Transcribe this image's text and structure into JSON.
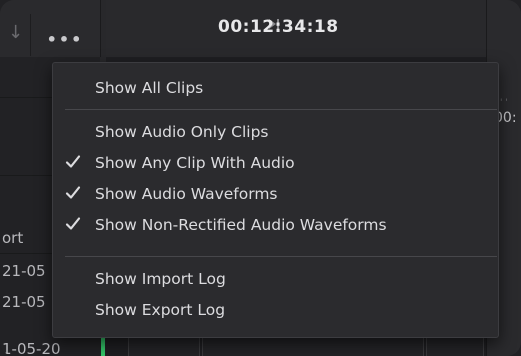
{
  "toolbar": {
    "more_label": "•••",
    "arrow_glyph": "↓"
  },
  "viewer": {
    "timecode": "00:12:34:18"
  },
  "ruler": {
    "timecode_partial": "00:"
  },
  "left_list": {
    "cells": [
      "ort",
      "21-05",
      "21-05",
      "1-05-20"
    ]
  },
  "menu": {
    "groups": [
      {
        "items": [
          {
            "label": "Show All Clips",
            "checked": false
          }
        ]
      },
      {
        "items": [
          {
            "label": "Show Audio Only Clips",
            "checked": false
          },
          {
            "label": "Show Any Clip With Audio",
            "checked": true
          },
          {
            "label": "Show Audio Waveforms",
            "checked": true
          },
          {
            "label": "Show Non-Rectified Audio Waveforms",
            "checked": true
          }
        ]
      },
      {
        "items": [
          {
            "label": "Show Import Log",
            "checked": false
          },
          {
            "label": "Show Export Log",
            "checked": false
          }
        ]
      }
    ]
  },
  "colors": {
    "background": "#212124",
    "menu_bg": "#2b2b2e",
    "menu_text": "#dcdcdf",
    "accent_green": "#34c86a"
  }
}
